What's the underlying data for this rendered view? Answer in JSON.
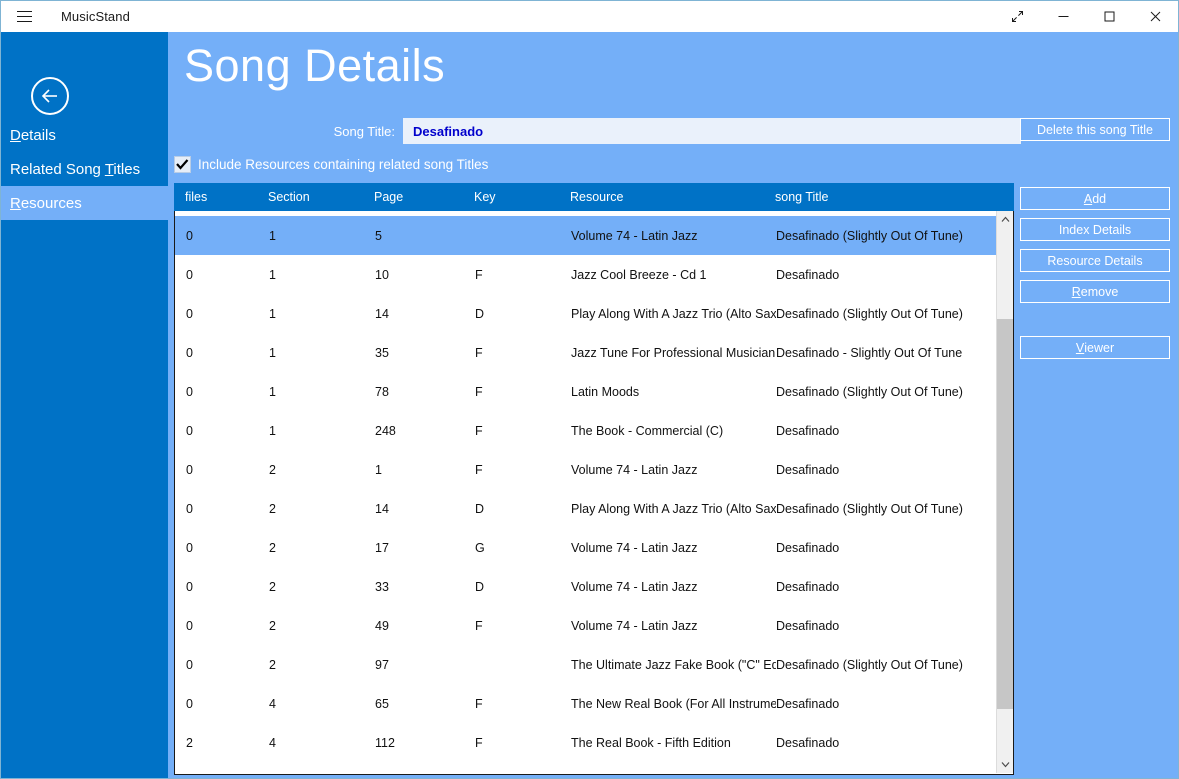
{
  "window": {
    "app_title": "MusicStand",
    "menu_icon": "hamburger-icon",
    "controls": {
      "restore_label": "restore",
      "minimize_label": "minimize",
      "maximize_label": "maximize",
      "close_label": "close"
    }
  },
  "sidebar": {
    "back_icon": "back-arrow-icon",
    "items": [
      {
        "label": "Details",
        "accel": "D",
        "active": false
      },
      {
        "label": "Related Song Titles",
        "accel": "T",
        "active": false
      },
      {
        "label": "Resources",
        "accel": "R",
        "active": true
      }
    ]
  },
  "header": {
    "title": "Song Details"
  },
  "form": {
    "song_title_label": "Song Title:",
    "song_title_value": "Desafinado",
    "song_title_placeholder": "",
    "include_checkbox_label": "Include Resources containing related song Titles",
    "include_checkbox_checked": true
  },
  "table": {
    "columns": [
      "files",
      "Section",
      "Page",
      "Key",
      "Resource",
      "song Title"
    ],
    "rows": [
      {
        "files": "0",
        "section": "1",
        "page": "5",
        "key": "",
        "resource": "Volume 74 - Latin Jazz",
        "song": "Desafinado (Slightly Out Of Tune)",
        "selected": true
      },
      {
        "files": "0",
        "section": "1",
        "page": "10",
        "key": "F",
        "resource": "Jazz Cool Breeze - Cd 1",
        "song": "Desafinado",
        "selected": false
      },
      {
        "files": "0",
        "section": "1",
        "page": "14",
        "key": "D",
        "resource": "Play Along With A Jazz Trio (Alto Sax...",
        "song": "Desafinado (Slightly Out Of Tune)",
        "selected": false
      },
      {
        "files": "0",
        "section": "1",
        "page": "35",
        "key": "F",
        "resource": "Jazz Tune For Professional Musician",
        "song": "Desafinado - Slightly Out Of Tune",
        "selected": false
      },
      {
        "files": "0",
        "section": "1",
        "page": "78",
        "key": "F",
        "resource": "Latin Moods",
        "song": "Desafinado (Slightly Out Of Tune)",
        "selected": false
      },
      {
        "files": "0",
        "section": "1",
        "page": "248",
        "key": "F",
        "resource": "The Book - Commercial (C)",
        "song": "Desafinado",
        "selected": false
      },
      {
        "files": "0",
        "section": "2",
        "page": "1",
        "key": "F",
        "resource": "Volume 74 - Latin Jazz",
        "song": "Desafinado",
        "selected": false
      },
      {
        "files": "0",
        "section": "2",
        "page": "14",
        "key": "D",
        "resource": "Play Along With A Jazz Trio (Alto Sax)",
        "song": "Desafinado (Slightly Out Of Tune)",
        "selected": false
      },
      {
        "files": "0",
        "section": "2",
        "page": "17",
        "key": "G",
        "resource": "Volume 74 - Latin Jazz",
        "song": "Desafinado",
        "selected": false
      },
      {
        "files": "0",
        "section": "2",
        "page": "33",
        "key": "D",
        "resource": "Volume 74 - Latin Jazz",
        "song": "Desafinado",
        "selected": false
      },
      {
        "files": "0",
        "section": "2",
        "page": "49",
        "key": "F",
        "resource": "Volume 74 - Latin Jazz",
        "song": "Desafinado",
        "selected": false
      },
      {
        "files": "0",
        "section": "2",
        "page": "97",
        "key": "",
        "resource": "The Ultimate Jazz Fake Book (\"C\" Edit...",
        "song": "Desafinado (Slightly Out Of Tune)",
        "selected": false
      },
      {
        "files": "0",
        "section": "4",
        "page": "65",
        "key": "F",
        "resource": "The New Real Book (For All Instrume...",
        "song": "Desafinado",
        "selected": false
      },
      {
        "files": "2",
        "section": "4",
        "page": "112",
        "key": "F",
        "resource": "The Real Book - Fifth Edition",
        "song": "Desafinado",
        "selected": false
      }
    ]
  },
  "buttons": {
    "delete_song_title": "Delete this song Title",
    "add": "Add",
    "add_accel": "A",
    "index_details": "Index Details",
    "resource_details": "Resource Details",
    "remove": "Remove",
    "remove_accel": "R",
    "viewer": "Viewer",
    "viewer_accel": "V"
  },
  "colors": {
    "accent_dark": "#0072C6",
    "accent_light": "#74AFF8",
    "input_bg": "#eaf1fb",
    "input_text": "#0000cc",
    "white": "#ffffff"
  }
}
